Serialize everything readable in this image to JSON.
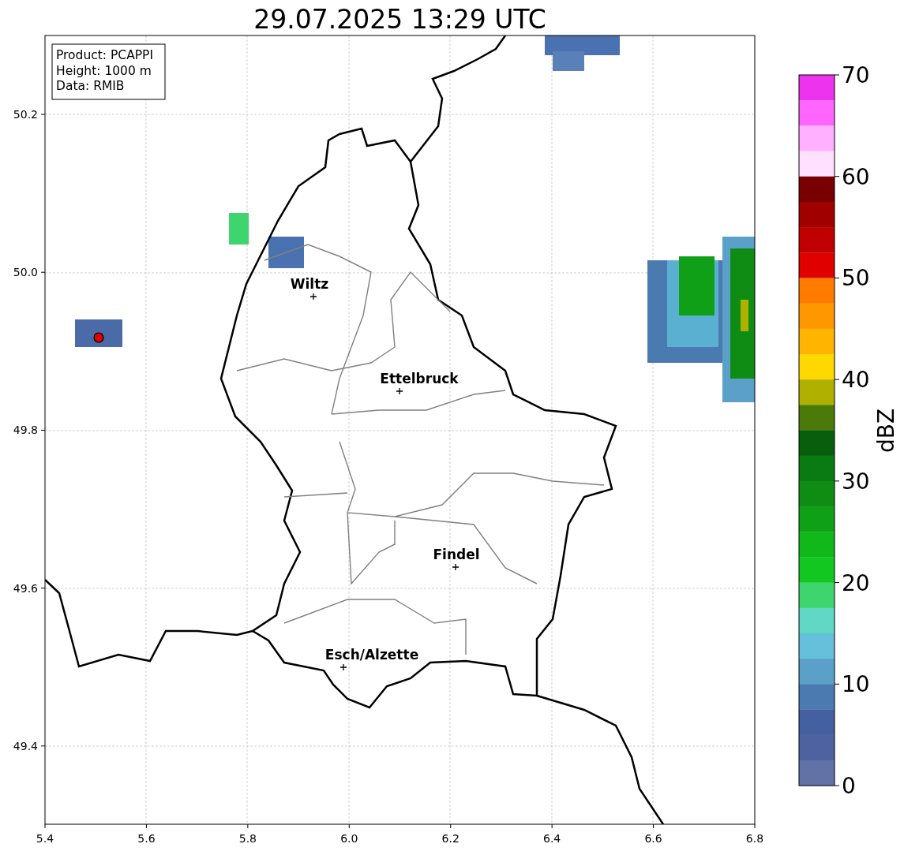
{
  "title": "29.07.2025 13:29 UTC",
  "info_box": [
    "Product: PCAPPI",
    "Height: 1000 m",
    "Data: RMIB"
  ],
  "places": [
    {
      "name": "Wiltz"
    },
    {
      "name": "Ettelbruck"
    },
    {
      "name": "Findel"
    },
    {
      "name": "Esch/Alzette"
    }
  ],
  "x_axis": {
    "ticks": [
      "5.4",
      "5.6",
      "5.8",
      "6.0",
      "6.2",
      "6.4",
      "6.6",
      "6.8"
    ]
  },
  "y_axis": {
    "ticks": [
      "50.2",
      "50.0",
      "49.8",
      "49.6",
      "49.4"
    ]
  },
  "colorbar": {
    "label": "dBZ",
    "ticks": [
      "70",
      "60",
      "50",
      "40",
      "30",
      "20",
      "10",
      "0"
    ],
    "bands": [
      {
        "color": "#ee33ee"
      },
      {
        "color": "#ff66ff"
      },
      {
        "color": "#ffb0ff"
      },
      {
        "color": "#ffe0ff"
      },
      {
        "color": "#780000"
      },
      {
        "color": "#a00000"
      },
      {
        "color": "#c00000"
      },
      {
        "color": "#e00000"
      },
      {
        "color": "#ff7c00"
      },
      {
        "color": "#ff9800"
      },
      {
        "color": "#ffb400"
      },
      {
        "color": "#ffd800"
      },
      {
        "color": "#b0b000"
      },
      {
        "color": "#4a7a0a"
      },
      {
        "color": "#085e0c"
      },
      {
        "color": "#0a7a12"
      },
      {
        "color": "#0e8c14"
      },
      {
        "color": "#10a018"
      },
      {
        "color": "#10b81a"
      },
      {
        "color": "#12c820"
      },
      {
        "color": "#3ed46e"
      },
      {
        "color": "#60d8c4"
      },
      {
        "color": "#66c0dc"
      },
      {
        "color": "#5aa0c8"
      },
      {
        "color": "#4a7ab0"
      },
      {
        "color": "#4460a0"
      },
      {
        "color": "#4f62a0"
      },
      {
        "color": "#6272a6"
      }
    ]
  }
}
